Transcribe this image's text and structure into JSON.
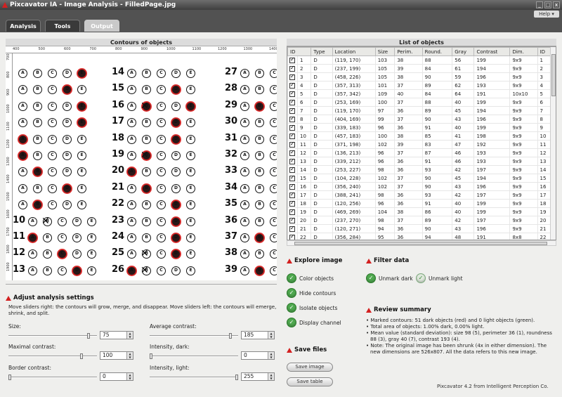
{
  "window": {
    "title": "Pixcavator IA - Image Analysis - FilledPage.jpg"
  },
  "menu": {
    "help_label": "Help"
  },
  "tabs": [
    {
      "label": "Analysis"
    },
    {
      "label": "Tools"
    },
    {
      "label": "Output"
    }
  ],
  "contours_panel": {
    "title": "Contours of objects",
    "ruler_top": [
      "400",
      "500",
      "600",
      "700",
      "800",
      "900",
      "1000",
      "1100",
      "1200",
      "1300",
      "1400"
    ],
    "ruler_left": [
      "700",
      "800",
      "900",
      "1000",
      "1100",
      "1200",
      "1300",
      "1400",
      "1500",
      "1600",
      "1700",
      "1800",
      "1900"
    ]
  },
  "answer_sheet": {
    "columns": [
      {
        "start": 1,
        "count": 13
      },
      {
        "start": 14,
        "count": 13
      },
      {
        "start": 27,
        "count": 13
      }
    ],
    "letters": [
      "A",
      "B",
      "C",
      "D",
      "E"
    ]
  },
  "settings": {
    "title": "Adjust analysis settings",
    "hint": "Move sliders right: the contours will grow, merge, and disappear. Move sliders left: the contours will emerge, shrink, and split.",
    "sliders": [
      {
        "label": "Size:",
        "value": "75",
        "level": 0.92
      },
      {
        "label": "Average contrast:",
        "value": "185",
        "level": 0.93
      },
      {
        "label": "Maximal contrast:",
        "value": "100",
        "level": 0.84
      },
      {
        "label": "Intensity, dark:",
        "value": "0",
        "level": 0.0
      },
      {
        "label": "Border contrast:",
        "value": "0",
        "level": 0.0
      },
      {
        "label": "Intensity, light:",
        "value": "255",
        "level": 1.0
      }
    ]
  },
  "objects_table": {
    "title": "List of objects",
    "headers": [
      "ID",
      "Type",
      "Location",
      "Size",
      "Perim.",
      "Round.",
      "Gray",
      "Contrast",
      "Dim.",
      "ID"
    ],
    "rows": [
      [
        "1",
        "D",
        "(119, 170)",
        "103",
        "38",
        "88",
        "56",
        "199",
        "9x9",
        "1"
      ],
      [
        "2",
        "D",
        "(237, 199)",
        "105",
        "39",
        "84",
        "61",
        "194",
        "9x9",
        "2"
      ],
      [
        "3",
        "D",
        "(458, 226)",
        "105",
        "38",
        "90",
        "59",
        "196",
        "9x9",
        "3"
      ],
      [
        "4",
        "D",
        "(357, 313)",
        "101",
        "37",
        "89",
        "62",
        "193",
        "9x9",
        "4"
      ],
      [
        "5",
        "D",
        "(357, 342)",
        "109",
        "40",
        "84",
        "64",
        "191",
        "10x10",
        "5"
      ],
      [
        "6",
        "D",
        "(253, 169)",
        "100",
        "37",
        "88",
        "40",
        "199",
        "9x9",
        "6"
      ],
      [
        "7",
        "D",
        "(119, 170)",
        "97",
        "36",
        "89",
        "45",
        "194",
        "9x9",
        "7"
      ],
      [
        "8",
        "D",
        "(404, 169)",
        "99",
        "37",
        "90",
        "43",
        "196",
        "9x9",
        "8"
      ],
      [
        "9",
        "D",
        "(339, 183)",
        "96",
        "36",
        "91",
        "40",
        "199",
        "9x9",
        "9"
      ],
      [
        "10",
        "D",
        "(457, 183)",
        "100",
        "38",
        "85",
        "41",
        "198",
        "9x9",
        "10"
      ],
      [
        "11",
        "D",
        "(371, 198)",
        "102",
        "39",
        "83",
        "47",
        "192",
        "9x9",
        "11"
      ],
      [
        "12",
        "D",
        "(136, 213)",
        "96",
        "37",
        "87",
        "46",
        "193",
        "9x9",
        "12"
      ],
      [
        "13",
        "D",
        "(339, 212)",
        "96",
        "36",
        "91",
        "46",
        "193",
        "9x9",
        "13"
      ],
      [
        "14",
        "D",
        "(253, 227)",
        "98",
        "36",
        "93",
        "42",
        "197",
        "9x9",
        "14"
      ],
      [
        "15",
        "D",
        "(104, 228)",
        "102",
        "37",
        "90",
        "45",
        "194",
        "9x9",
        "15"
      ],
      [
        "16",
        "D",
        "(356, 240)",
        "102",
        "37",
        "90",
        "43",
        "196",
        "9x9",
        "16"
      ],
      [
        "17",
        "D",
        "(388, 241)",
        "98",
        "36",
        "93",
        "42",
        "197",
        "9x9",
        "17"
      ],
      [
        "18",
        "D",
        "(120, 256)",
        "96",
        "36",
        "91",
        "40",
        "199",
        "9x9",
        "18"
      ],
      [
        "19",
        "D",
        "(469, 269)",
        "104",
        "38",
        "86",
        "40",
        "199",
        "9x9",
        "19"
      ],
      [
        "20",
        "D",
        "(237, 270)",
        "98",
        "37",
        "89",
        "42",
        "197",
        "9x9",
        "20"
      ],
      [
        "21",
        "D",
        "(120, 271)",
        "94",
        "36",
        "90",
        "43",
        "196",
        "9x9",
        "21"
      ],
      [
        "22",
        "D",
        "(356, 284)",
        "95",
        "36",
        "94",
        "48",
        "191",
        "8x8",
        "22"
      ]
    ]
  },
  "explore": {
    "title": "Explore image",
    "options": [
      "Color objects",
      "Hide contours",
      "Isolate objects",
      "Display channel"
    ]
  },
  "filter": {
    "title": "Filter data",
    "options": [
      "Unmark dark",
      "Unmark light"
    ]
  },
  "save": {
    "title": "Save files",
    "image_button": "Save image",
    "table_button": "Save table"
  },
  "review": {
    "title": "Review summary",
    "lines": [
      "• Marked contours: 51 dark objects (red) and 0 light objects (green).",
      "• Total area of objects: 1.00% dark, 0.00% light.",
      "• Mean value (standard deviation): size 98 (5), perimeter 36 (1), roundness 88 (3), gray 40 (7), contrast 193 (4).",
      "• Note: The original image has been shrunk (4x in either dimension). The new dimensions are 526x807. All the data refers to this new image."
    ]
  },
  "footer": {
    "text": "Pixcavator 4.2 from Intelligent Perception Co."
  },
  "colors": {
    "accent_red": "#d32020",
    "check_green": "#4fa84f"
  }
}
